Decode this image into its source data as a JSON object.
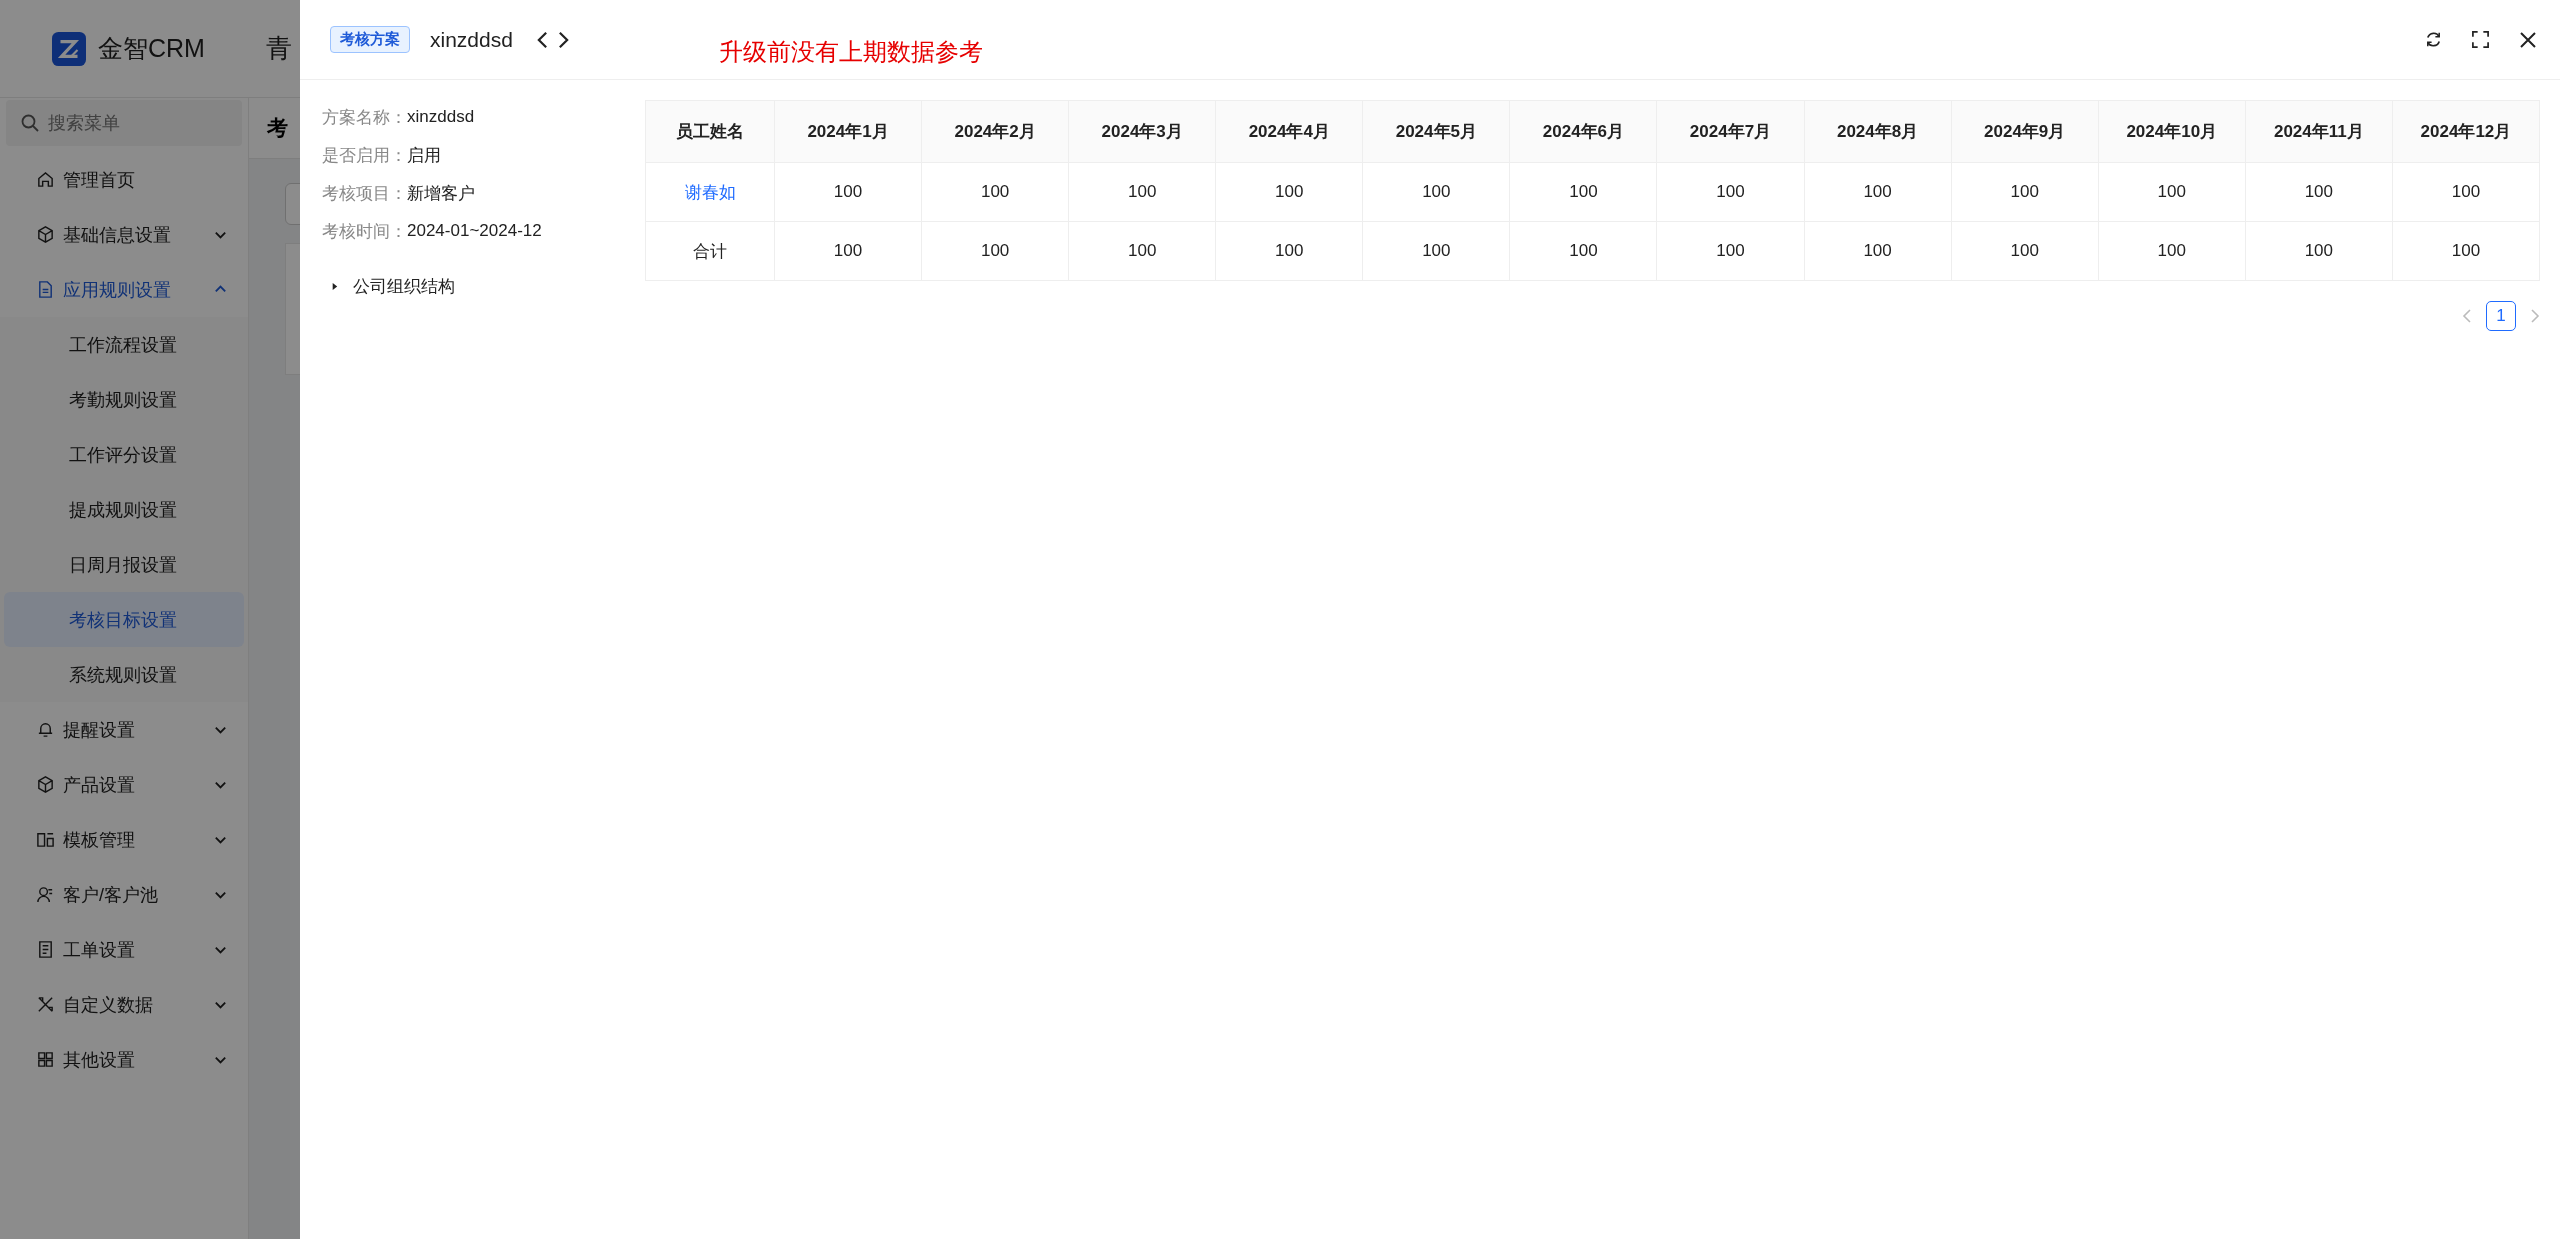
{
  "app": {
    "logo_text": "金智CRM",
    "top_bar_text": "青",
    "page_title": "考"
  },
  "sidebar": {
    "search": {
      "placeholder": "搜索菜单"
    },
    "items": [
      {
        "label": "管理首页"
      },
      {
        "label": "基础信息设置",
        "expanded": false
      },
      {
        "label": "应用规则设置",
        "expanded": true,
        "children": [
          {
            "label": "工作流程设置",
            "selected": false
          },
          {
            "label": "考勤规则设置",
            "selected": false
          },
          {
            "label": "工作评分设置",
            "selected": false
          },
          {
            "label": "提成规则设置",
            "selected": false
          },
          {
            "label": "日周月报设置",
            "selected": false
          },
          {
            "label": "考核目标设置",
            "selected": true
          },
          {
            "label": "系统规则设置",
            "selected": false
          }
        ]
      },
      {
        "label": "提醒设置",
        "expanded": false
      },
      {
        "label": "产品设置",
        "expanded": false
      },
      {
        "label": "模板管理",
        "expanded": false
      },
      {
        "label": "客户/客户池",
        "expanded": false
      },
      {
        "label": "工单设置",
        "expanded": false
      },
      {
        "label": "自定义数据",
        "expanded": false
      },
      {
        "label": "其他设置",
        "expanded": false
      }
    ]
  },
  "drawer": {
    "tag": "考核方案",
    "title": "xinzddsd",
    "notice": "升级前没有上期数据参考",
    "info": [
      {
        "label": "方案名称：",
        "value": "xinzddsd"
      },
      {
        "label": "是否启用：",
        "value": "启用"
      },
      {
        "label": "考核项目：",
        "value": "新增客户"
      },
      {
        "label": "考核时间：",
        "value": "2024-01~2024-12"
      }
    ],
    "tree": {
      "label": "公司组织结构",
      "expanded": false
    },
    "table": {
      "columns": [
        "员工姓名",
        "2024年1月",
        "2024年2月",
        "2024年3月",
        "2024年4月",
        "2024年5月",
        "2024年6月",
        "2024年7月",
        "2024年8月",
        "2024年9月",
        "2024年10月",
        "2024年11月",
        "2024年12月"
      ],
      "rows": [
        {
          "kind": "employee",
          "cells": [
            "谢春如",
            "100",
            "100",
            "100",
            "100",
            "100",
            "100",
            "100",
            "100",
            "100",
            "100",
            "100",
            "100"
          ]
        },
        {
          "kind": "total",
          "cells": [
            "合计",
            "100",
            "100",
            "100",
            "100",
            "100",
            "100",
            "100",
            "100",
            "100",
            "100",
            "100",
            "100"
          ]
        }
      ]
    },
    "pagination": {
      "pages": [
        {
          "label": "1",
          "selected": true
        }
      ]
    }
  }
}
